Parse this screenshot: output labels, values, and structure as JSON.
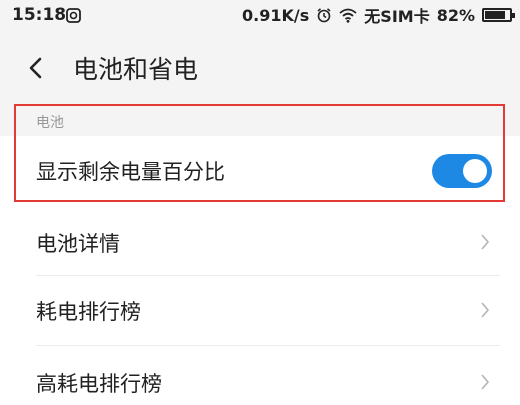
{
  "status_bar": {
    "time": "15:18",
    "network_speed": "0.91K/s",
    "sim_status": "无SIM卡",
    "battery_percent": "82%",
    "battery_level": 0.82
  },
  "header": {
    "title": "电池和省电"
  },
  "section": {
    "label": "电池"
  },
  "settings": {
    "show_percentage": {
      "label": "显示剩余电量百分比",
      "enabled": true
    },
    "items": [
      {
        "label": "电池详情"
      },
      {
        "label": "耗电排行榜"
      },
      {
        "label": "高耗电排行榜"
      }
    ]
  },
  "colors": {
    "toggle_on": "#1e88e5",
    "highlight": "#e53935",
    "background": "#f4f4f4"
  }
}
